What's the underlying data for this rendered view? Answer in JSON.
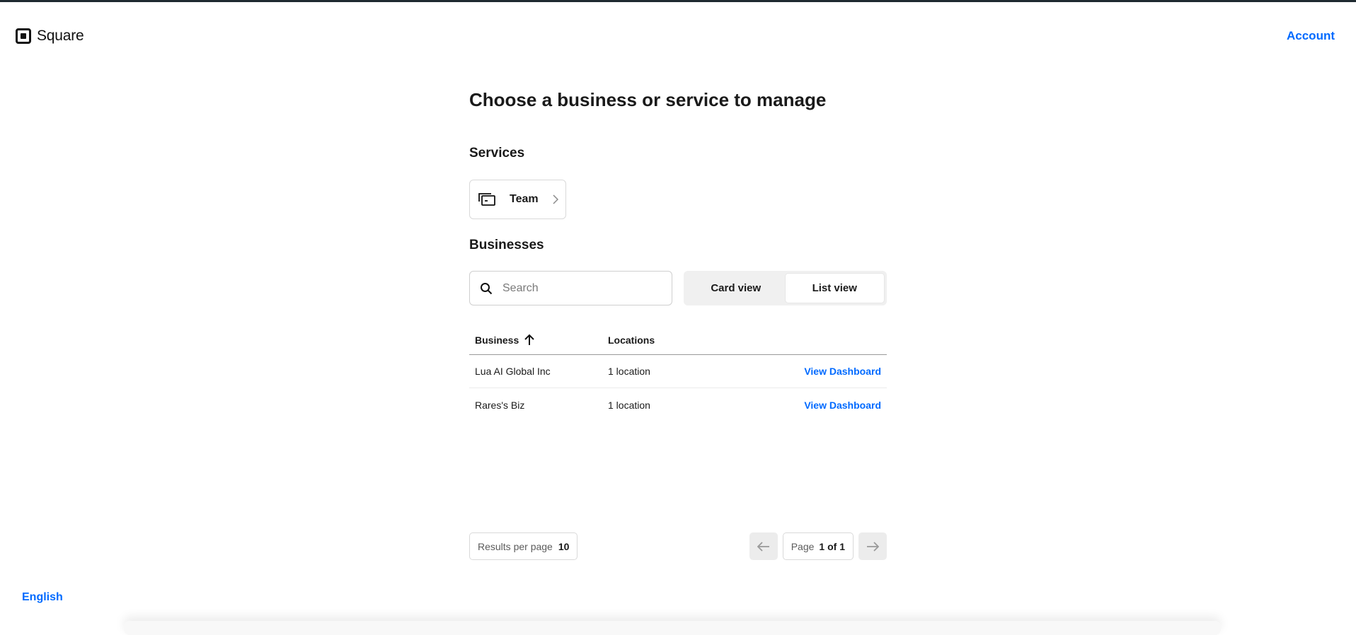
{
  "header": {
    "brand": "Square",
    "account_label": "Account"
  },
  "main": {
    "title": "Choose a business or service to manage",
    "services": {
      "title": "Services",
      "items": [
        {
          "label": "Team",
          "icon": "team-icon"
        }
      ]
    },
    "businesses": {
      "title": "Businesses",
      "search": {
        "placeholder": "Search",
        "value": ""
      },
      "view_toggle": {
        "options": [
          "Card view",
          "List view"
        ],
        "selected": "List view"
      },
      "table": {
        "columns": [
          "Business",
          "Locations"
        ],
        "sort": {
          "column": "Business",
          "direction": "ascending",
          "icon": "arrow-up-icon"
        },
        "rows": [
          {
            "business": "Lua AI Global Inc",
            "locations": "1 location",
            "action": "View Dashboard"
          },
          {
            "business": "Rares's Biz",
            "locations": "1 location",
            "action": "View Dashboard"
          }
        ]
      },
      "pagination": {
        "results_per_page_label": "Results per page",
        "results_per_page_value": "10",
        "page_label": "Page",
        "page_value": "1 of 1"
      }
    }
  },
  "footer": {
    "language": "English"
  },
  "colors": {
    "accent": "#006aff",
    "text": "#1a1a1a",
    "border": "#d9d9d9",
    "toggle_bg": "#f0f0f0"
  }
}
